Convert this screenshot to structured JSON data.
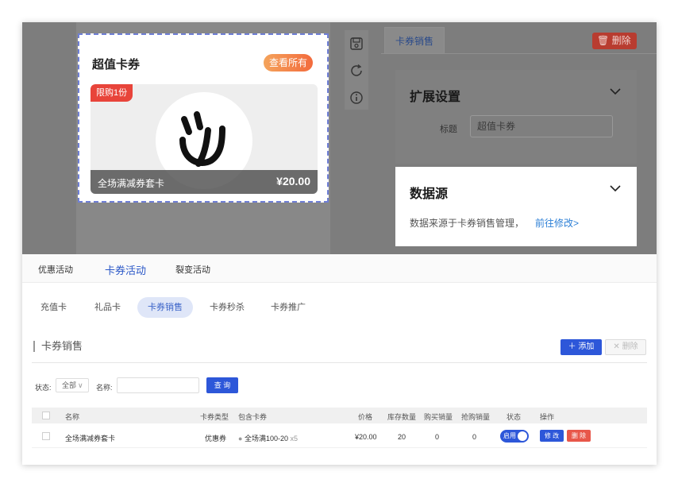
{
  "preview": {
    "card_title": "超值卡券",
    "view_all": "查看所有",
    "coupon": {
      "limit_tag": "限购1份",
      "name": "全场满减券套卡",
      "price": "¥20.00"
    }
  },
  "tools": [
    "save-icon",
    "refresh-icon",
    "info-icon"
  ],
  "settings": {
    "tab": "卡券销售",
    "delete": "删除",
    "extension": {
      "title": "扩展设置",
      "title_label": "标题",
      "title_value": "超值卡券"
    },
    "datasource": {
      "title": "数据源",
      "desc": "数据来源于卡券销售管理，",
      "link": "前往修改>"
    }
  },
  "main_tabs": [
    {
      "label": "优惠活动",
      "active": false
    },
    {
      "label": "卡券活动",
      "active": true
    },
    {
      "label": "裂变活动",
      "active": false
    }
  ],
  "sub_tabs": [
    {
      "label": "充值卡",
      "active": false
    },
    {
      "label": "礼品卡",
      "active": false
    },
    {
      "label": "卡券销售",
      "active": true
    },
    {
      "label": "卡券秒杀",
      "active": false
    },
    {
      "label": "卡券推广",
      "active": false
    }
  ],
  "section": {
    "title": "卡券销售",
    "add": "添加",
    "delete": "删除"
  },
  "filter": {
    "status_label": "状态:",
    "status_value": "全部",
    "name_label": "名称:",
    "query": "查 询"
  },
  "table": {
    "columns": [
      "名称",
      "卡券类型",
      "包含卡券",
      "价格",
      "库存数量",
      "购买销量",
      "抢购销量",
      "状态",
      "操作"
    ],
    "rows": [
      {
        "name": "全场满减券套卡",
        "type": "优惠券",
        "includes": "全场满100-20",
        "includes_count": "x5",
        "price": "¥20.00",
        "stock": "20",
        "bought": "0",
        "flash": "0",
        "status": "启用",
        "edit": "修 改",
        "remove": "删 除"
      }
    ]
  },
  "colors": {
    "primary": "#2d57d9",
    "danger": "#e8574a",
    "accent_gradient_start": "#f4a35b",
    "accent_gradient_end": "#f36b3d",
    "link": "#2c7fd6"
  }
}
